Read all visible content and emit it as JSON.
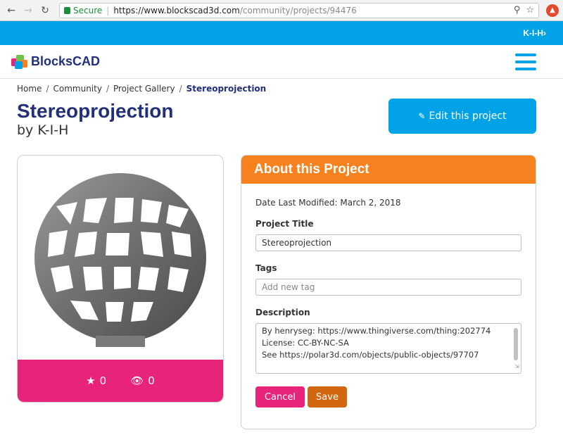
{
  "browser": {
    "secure_label": "Secure",
    "url_host": "https://www.blockscad3d.com",
    "url_path": "/community/projects/94476"
  },
  "topbar": {
    "user": "K-I-H›"
  },
  "header": {
    "logo_text": "BlocksCAD"
  },
  "breadcrumb": {
    "items": [
      "Home",
      "Community",
      "Project Gallery"
    ],
    "current": "Stereoprojection"
  },
  "project": {
    "title": "Stereoprojection",
    "byline": "by K-I-H",
    "edit_label": "Edit this project",
    "stars": "0",
    "views": "0"
  },
  "about": {
    "heading": "About this Project",
    "modified": "Date Last Modified: March 2, 2018",
    "title_label": "Project Title",
    "title_value": "Stereoprojection",
    "tags_label": "Tags",
    "tags_placeholder": "Add new tag",
    "description_label": "Description",
    "description_lines": [
      "By henryseg: https://www.thingiverse.com/thing:202774",
      "License: CC-BY-NC-SA",
      "See https://polar3d.com/objects/public-objects/97707"
    ],
    "cancel_label": "Cancel",
    "save_label": "Save"
  },
  "colors": {
    "brand_blue": "#01a3e6",
    "navy": "#22307a",
    "orange": "#f6821f",
    "pink": "#e8237a",
    "save": "#d3670f"
  }
}
